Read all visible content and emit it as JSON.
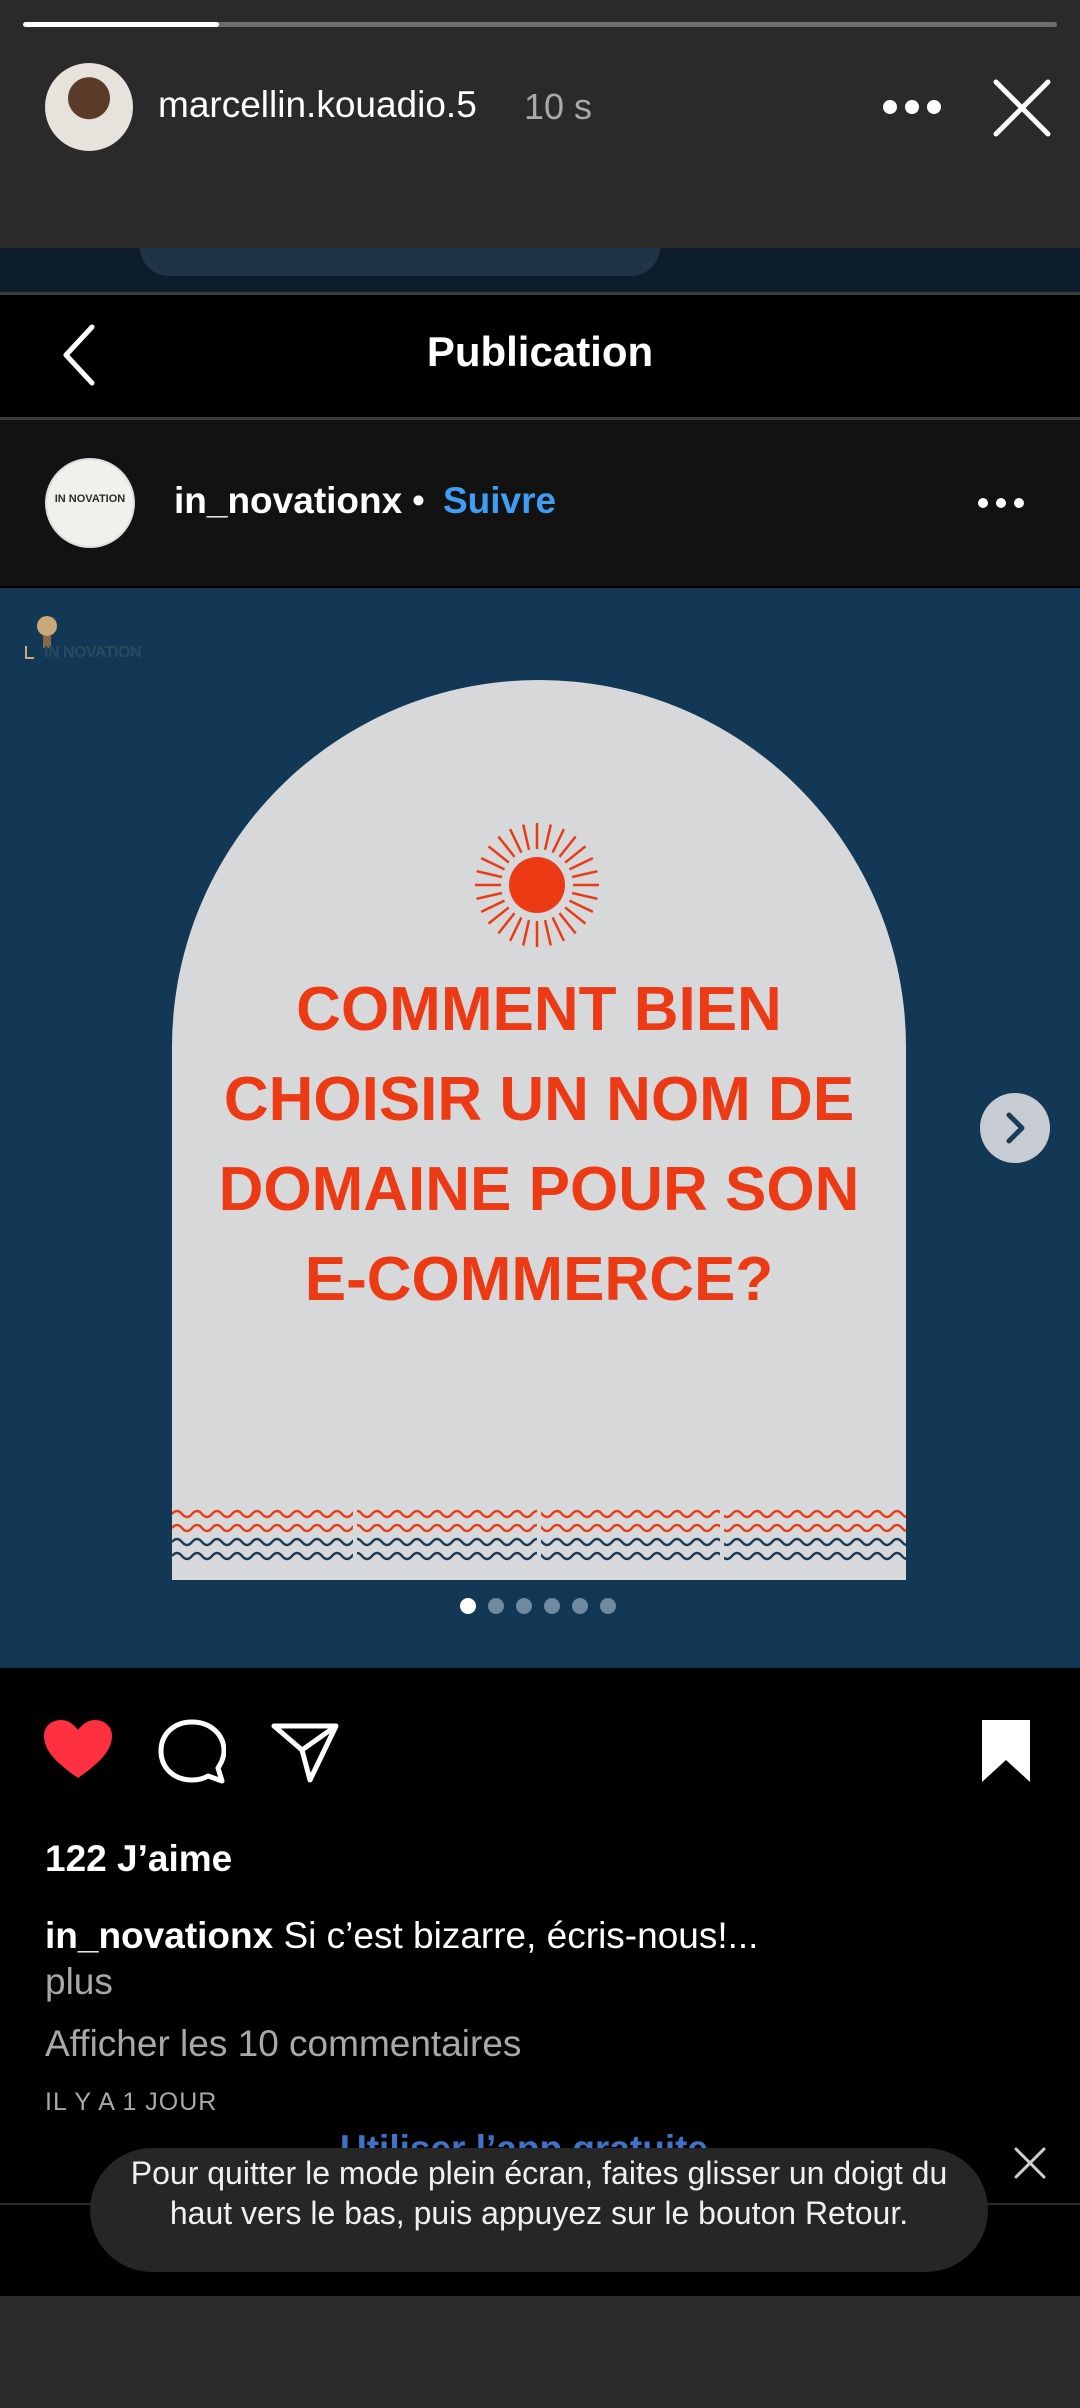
{
  "story": {
    "username": "marcellin.kouadio.5",
    "time": "10 s",
    "progress": 0.19
  },
  "post": {
    "page_title": "Publication",
    "username": "in_novationx",
    "dot": "•",
    "follow_label": "Suivre",
    "image": {
      "headline": "COMMENT BIEN CHOISIR UN NOM DE DOMAINE POUR SON E-COMMERCE?",
      "brand": "IN NOVATION",
      "slide_count": 6,
      "current_slide": 1
    },
    "likes": "122 J’aime",
    "caption_user": "in_novationx",
    "caption_text": " Si c’est bizarre, écris-nous!...",
    "caption_more": "plus",
    "view_comments": "Afficher les 10 commentaires",
    "date": "IL Y A 1 JOUR",
    "app_link": "Utiliser l’app gratuite"
  },
  "toast": {
    "text": "Pour quitter le mode plein écran, faites glisser un doigt du haut vers le bas, puis appuyez sur le bouton Retour."
  },
  "colors": {
    "accent_blue": "#3d9ef4",
    "like_red": "#ff3040",
    "post_bg": "#123856",
    "headline_orange": "#ec3a15",
    "arch_gray": "#d6d8da"
  },
  "icons": [
    "more-icon",
    "close-icon",
    "back-chevron-icon",
    "heart-icon",
    "comment-icon",
    "share-icon",
    "bookmark-icon",
    "next-arrow-icon",
    "sun-icon"
  ]
}
